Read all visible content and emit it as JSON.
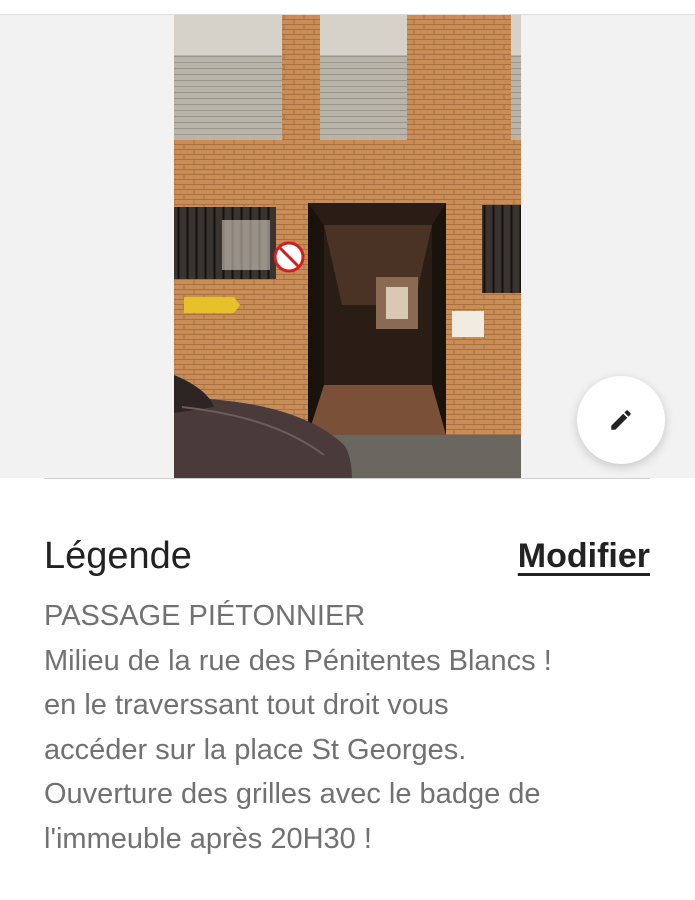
{
  "photo": {
    "image_description": "Entrée d'un passage piétonnier sous un immeuble en briques"
  },
  "edit_button": {
    "icon": "pencil-icon"
  },
  "caption": {
    "title": "Légende",
    "modify_label": "Modifier",
    "lines": [
      "PASSAGE PIÉTONNIER",
      "Milieu de la rue des Pénitentes Blancs !",
      "en le traverssant tout droit vous",
      "accéder sur la place St Georges.",
      "Ouverture des grilles avec le badge de",
      "l'immeuble après 20H30 !"
    ]
  },
  "colors": {
    "title_text": "#222222",
    "body_text": "#717171",
    "background": "#ffffff",
    "photo_backdrop": "#f2f2f2"
  }
}
